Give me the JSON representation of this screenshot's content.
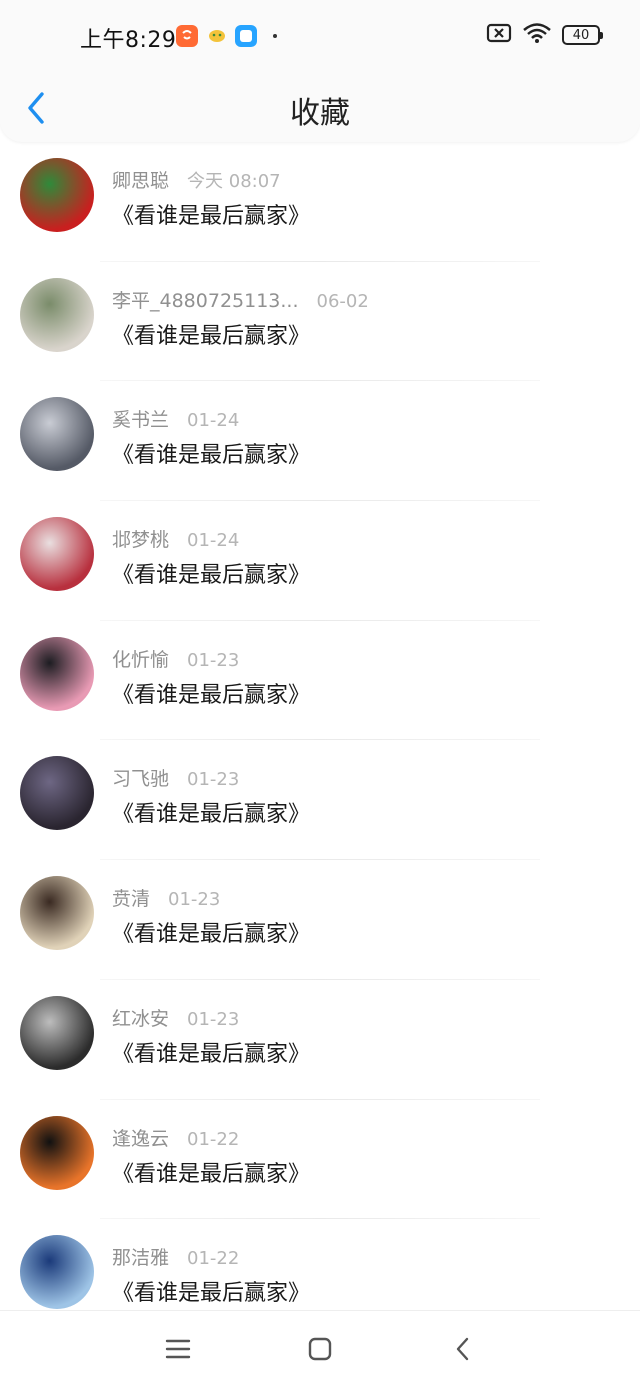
{
  "status_bar": {
    "time": "上午8:29",
    "battery": "40"
  },
  "header": {
    "title": "收藏"
  },
  "items": [
    {
      "name": "卿思聪",
      "time": "今天 08:07",
      "content": "《看谁是最后赢家》",
      "avatar_colors": [
        "#c91f1f",
        "#2f8a3a"
      ]
    },
    {
      "name": "李平_4880725113...",
      "time": "06-02",
      "content": "《看谁是最后赢家》",
      "avatar_colors": [
        "#d9d4cc",
        "#7a8c6a"
      ]
    },
    {
      "name": "奚书兰",
      "time": "01-24",
      "content": "《看谁是最后赢家》",
      "avatar_colors": [
        "#555a66",
        "#c9ccd4"
      ]
    },
    {
      "name": "邶梦桃",
      "time": "01-24",
      "content": "《看谁是最后赢家》",
      "avatar_colors": [
        "#b8303e",
        "#e9dfe0"
      ]
    },
    {
      "name": "化忻愉",
      "time": "01-23",
      "content": "《看谁是最后赢家》",
      "avatar_colors": [
        "#e89ab4",
        "#1d1d22"
      ]
    },
    {
      "name": "习飞驰",
      "time": "01-23",
      "content": "《看谁是最后赢家》",
      "avatar_colors": [
        "#2a2530",
        "#6e6784"
      ]
    },
    {
      "name": "贲清",
      "time": "01-23",
      "content": "《看谁是最后赢家》",
      "avatar_colors": [
        "#e0d2b8",
        "#3a2a22"
      ]
    },
    {
      "name": "红冰安",
      "time": "01-23",
      "content": "《看谁是最后赢家》",
      "avatar_colors": [
        "#2c2c2c",
        "#bdbdbd"
      ]
    },
    {
      "name": "逢逸云",
      "time": "01-22",
      "content": "《看谁是最后赢家》",
      "avatar_colors": [
        "#e8742a",
        "#111111"
      ]
    },
    {
      "name": "那洁雅",
      "time": "01-22",
      "content": "《看谁是最后赢家》",
      "avatar_colors": [
        "#9ec4e6",
        "#1b3a7a"
      ]
    }
  ],
  "colors": {
    "accent": "#1e8ff0",
    "name_gray": "#909090",
    "time_gray": "#b5b5b5"
  }
}
